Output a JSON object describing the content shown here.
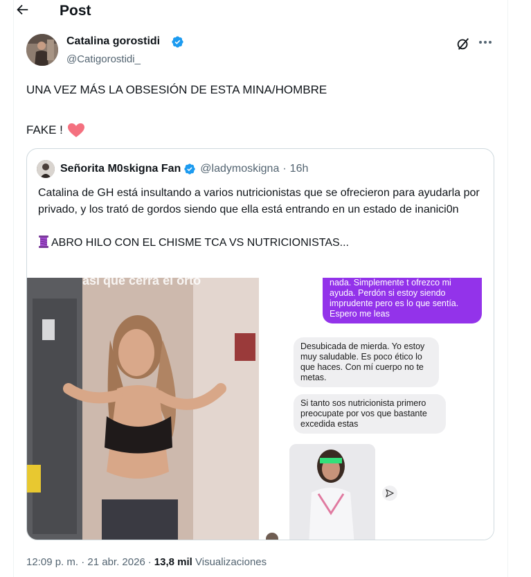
{
  "header": {
    "title": "Post"
  },
  "tweet": {
    "author": {
      "name": "Catalina gorostidi",
      "handle": "@Catigorostidi_"
    },
    "text_line1": "UNA VEZ MÁS LA OBSESIÓN DE ESTA MINA/HOMBRE",
    "text_line2": "FAKE !",
    "timestamp": "12:09 p. m. · 21 abr. 2026",
    "separator": "·",
    "views_count": "13,8 mil",
    "views_label": "Visualizaciones"
  },
  "quote": {
    "author": {
      "name": "Señorita M0skigna Fan",
      "handle": "@ladymoskigna",
      "dot": "·",
      "time": "16h"
    },
    "text_p1": "Catalina de GH está insultando a varios nutricionistas que se ofrecieron para ayudarla por privado, y los trató de gordos siendo que ella está entrando en un estado de inanici0n",
    "text_p2": "ABRO HILO CON EL CHISME TCA VS NUTRICIONISTAS...",
    "media": {
      "photo_overlay": "así que cerrá el orto",
      "chat_out": "nada. Simplemente t ofrezco mi ayuda. Perdón si estoy siendo imprudente pero es lo que sentía. Espero me leas",
      "chat_in1": "Desubicada de mierda. Yo estoy muy saludable. Es poco ético lo que haces. Con mí cuerpo no te metas.",
      "chat_in2": "Si tanto sos nutricionista primero preocupate por vos que bastante excedida estas"
    }
  },
  "colors": {
    "verified": "#1d9bf0",
    "text_secondary": "#536471",
    "border": "#cfd9de",
    "heart": "#f4707f",
    "chat_purple": "#9333ea"
  }
}
